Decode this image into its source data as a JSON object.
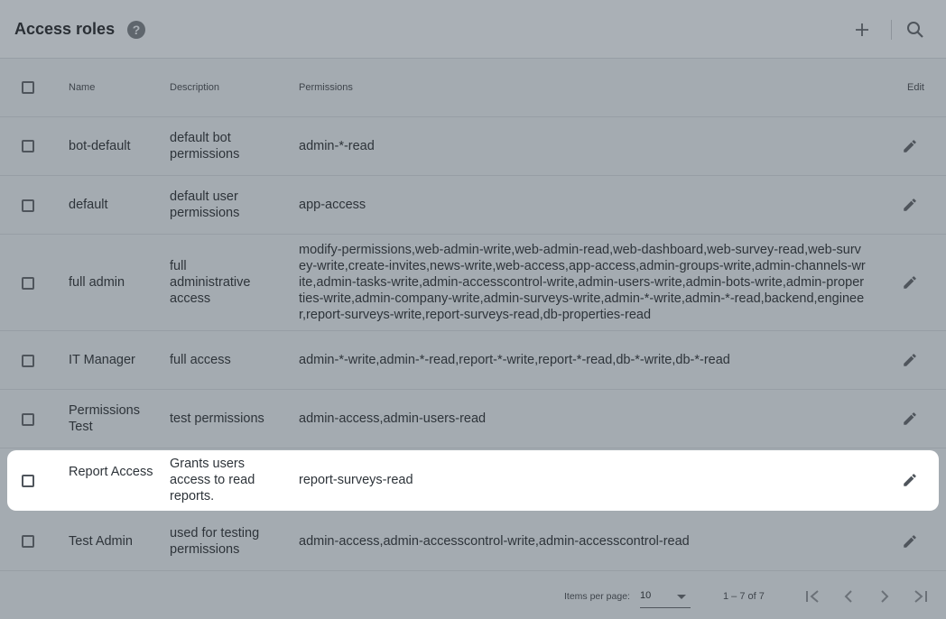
{
  "toolbar": {
    "title": "Access roles",
    "help_icon": "help-circle-icon",
    "add_icon": "plus-icon",
    "search_icon": "search-icon"
  },
  "table": {
    "columns": {
      "name": "Name",
      "description": "Description",
      "permissions": "Permissions",
      "edit": "Edit"
    },
    "rows": [
      {
        "name": "bot-default",
        "description": "default bot permissions",
        "permissions": "admin-*-read"
      },
      {
        "name": "default",
        "description": "default user permissions",
        "permissions": "app-access"
      },
      {
        "name": "full admin",
        "description": "full administrative access",
        "permissions": "modify-permissions,web-admin-write,web-admin-read,web-dashboard,web-survey-read,web-survey-write,create-invites,news-write,web-access,app-access,admin-groups-write,admin-channels-write,admin-tasks-write,admin-accesscontrol-write,admin-users-write,admin-bots-write,admin-properties-write,admin-company-write,admin-surveys-write,admin-*-write,admin-*-read,backend,engineer,report-surveys-write,report-surveys-read,db-properties-read"
      },
      {
        "name": "IT Manager",
        "description": "full access",
        "permissions": "admin-*-write,admin-*-read,report-*-write,report-*-read,db-*-write,db-*-read"
      },
      {
        "name": "Permissions Test",
        "description": "test permissions",
        "permissions": "admin-access,admin-users-read"
      },
      {
        "name": "Report Access",
        "description": "Grants users access to read reports.",
        "permissions": "report-surveys-read",
        "highlighted": true
      },
      {
        "name": "Test Admin",
        "description": "used for testing permissions",
        "permissions": "admin-access,admin-accesscontrol-write,admin-accesscontrol-read"
      }
    ]
  },
  "paginator": {
    "items_per_page_label": "Items per page:",
    "items_per_page": "10",
    "range_label": "1 – 7 of 7",
    "first_icon": "first-page-icon",
    "prev_icon": "chevron-left-icon",
    "next_icon": "chevron-right-icon",
    "last_icon": "last-page-icon"
  },
  "colors": {
    "overlay": "#a4abb1",
    "highlight_row": "#ffffff",
    "text": "#2e343a"
  }
}
